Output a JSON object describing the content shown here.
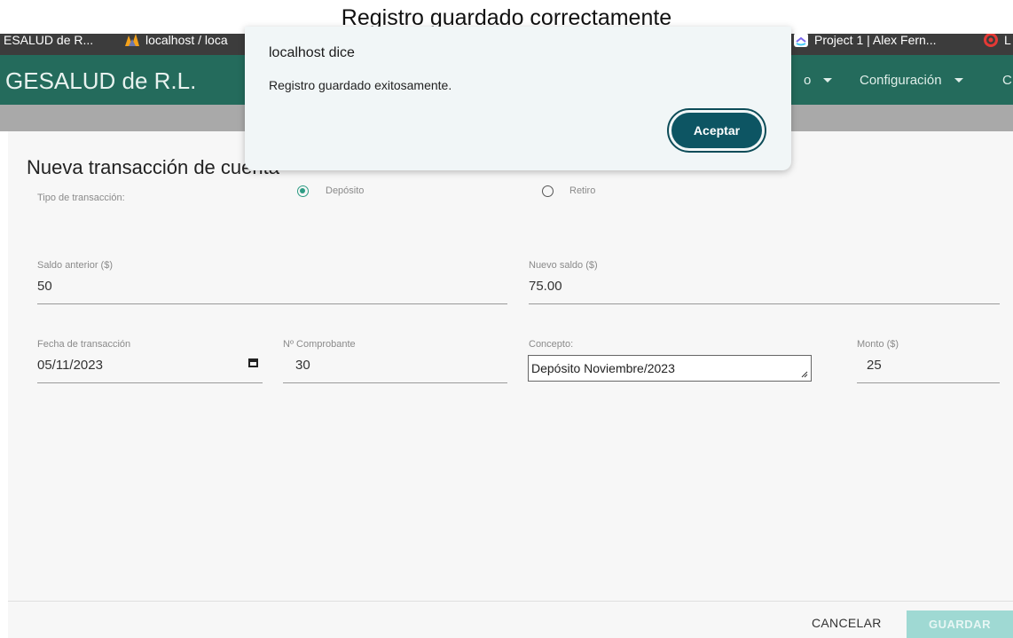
{
  "caption": "Registro guardado correctamente",
  "bookmarks": [
    {
      "label": "ESALUD de R...",
      "icon": "app-icon"
    },
    {
      "label": "localhost / loca",
      "icon": "phpmyadmin-icon"
    },
    {
      "label": "Project 1 | Alex Fern...",
      "icon": "clickup-icon"
    },
    {
      "label": "L",
      "icon": "target-icon"
    }
  ],
  "header": {
    "brand": "GESALUD de R.L.",
    "nav": [
      {
        "label": "o"
      },
      {
        "label": "Configuración"
      },
      {
        "label": "C"
      }
    ],
    "color": "#246b5c"
  },
  "form": {
    "title": "Nueva transacción de cuenta",
    "tipo_label": "Tipo de transacción:",
    "radio_deposito": "Depósito",
    "radio_retiro": "Retiro",
    "saldo_anterior_label": "Saldo anterior ($)",
    "saldo_anterior_value": "50",
    "nuevo_saldo_label": "Nuevo saldo ($)",
    "nuevo_saldo_value": "75.00",
    "fecha_label": "Fecha de transacción",
    "fecha_value": "05/11/2023",
    "comprobante_label": "Nº Comprobante",
    "comprobante_value": "30",
    "concepto_label": "Concepto:",
    "concepto_value": "Depósito Noviembre/2023",
    "monto_label": "Monto ($)",
    "monto_value": "25"
  },
  "footer": {
    "cancel_label": "CANCELAR",
    "save_label": "GUARDAR"
  },
  "dialog": {
    "title": "localhost dice",
    "message": "Registro guardado exitosamente.",
    "ok_label": "Aceptar"
  }
}
